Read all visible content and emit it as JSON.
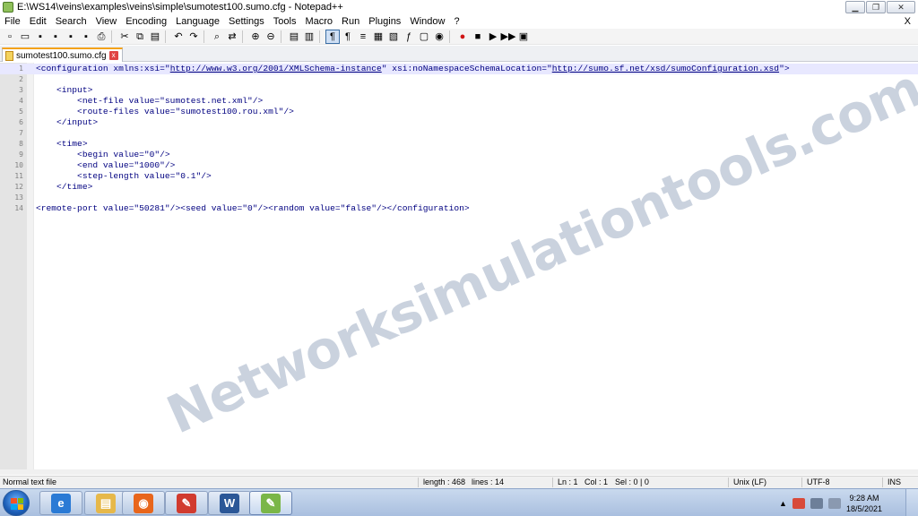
{
  "window": {
    "title": "E:\\WS14\\veins\\examples\\veins\\simple\\sumotest100.sumo.cfg - Notepad++",
    "minimize_glyph": "▁",
    "maximize_glyph": "❐",
    "close_glyph": "✕"
  },
  "menu": {
    "items": [
      "File",
      "Edit",
      "Search",
      "View",
      "Encoding",
      "Language",
      "Settings",
      "Tools",
      "Macro",
      "Run",
      "Plugins",
      "Window",
      "?"
    ],
    "doc_close": "X"
  },
  "toolbar": {
    "icons": [
      "new-file-icon",
      "open-file-icon",
      "save-icon",
      "save-all-icon",
      "close-icon",
      "close-all-icon",
      "print-icon",
      "cut-icon",
      "copy-icon",
      "paste-icon",
      "undo-icon",
      "redo-icon",
      "find-icon",
      "replace-icon",
      "zoom-in-icon",
      "zoom-out-icon",
      "sync-vertical-icon",
      "sync-horizontal-icon",
      "word-wrap-icon",
      "show-all-chars-icon",
      "indent-guide-icon",
      "user-language-icon",
      "doc-map-icon",
      "function-list-icon",
      "folder-workspace-icon",
      "monitoring-icon",
      "record-macro-icon",
      "stop-macro-icon",
      "play-macro-icon",
      "run-macro-multiple-icon",
      "save-macro-icon"
    ],
    "glyphs": [
      "▫",
      "▭",
      "▪",
      "▪",
      "▪",
      "▪",
      "⎙",
      "✂",
      "⧉",
      "▤",
      "↶",
      "↷",
      "⌕",
      "⇄",
      "⊕",
      "⊖",
      "▤",
      "▥",
      "¶",
      "¶",
      "≡",
      "▦",
      "▧",
      "ƒ",
      "▢",
      "◉",
      "●",
      "■",
      "▶",
      "▶▶",
      "▣"
    ]
  },
  "tab": {
    "label": "sumotest100.sumo.cfg",
    "close_glyph": "x"
  },
  "editor": {
    "lines": [
      {
        "n": "1",
        "text": "<configuration xmlns:xsi=\"",
        "link1": "http://www.w3.org/2001/XMLSchema-instance",
        "mid": "\" xsi:noNamespaceSchemaLocation=\"",
        "link2": "http://sumo.sf.net/xsd/sumoConfiguration.xsd",
        "end": "\">"
      },
      {
        "n": "2",
        "text": ""
      },
      {
        "n": "3",
        "text": "    <input>"
      },
      {
        "n": "4",
        "text": "        <net-file value=\"sumotest.net.xml\"/>"
      },
      {
        "n": "5",
        "text": "        <route-files value=\"sumotest100.rou.xml\"/>"
      },
      {
        "n": "6",
        "text": "    </input>"
      },
      {
        "n": "7",
        "text": ""
      },
      {
        "n": "8",
        "text": "    <time>"
      },
      {
        "n": "9",
        "text": "        <begin value=\"0\"/>"
      },
      {
        "n": "10",
        "text": "        <end value=\"1000\"/>"
      },
      {
        "n": "11",
        "text": "        <step-length value=\"0.1\"/>"
      },
      {
        "n": "12",
        "text": "    </time>"
      },
      {
        "n": "13",
        "text": ""
      },
      {
        "n": "14",
        "text": "<remote-port value=\"50281\"/><seed value=\"0\"/><random value=\"false\"/></configuration>"
      }
    ]
  },
  "watermark": "Networksimulationtools.com",
  "status": {
    "filetype": "Normal text file",
    "length": "length : 468",
    "lines": "lines : 14",
    "ln": "Ln : 1",
    "col": "Col : 1",
    "sel": "Sel : 0 | 0",
    "eol": "Unix (LF)",
    "encoding": "UTF-8",
    "mode": "INS"
  },
  "taskbar": {
    "apps": [
      {
        "name": "internet-explorer-icon",
        "glyph": "e",
        "color": "#2a7ad5"
      },
      {
        "name": "file-explorer-icon",
        "glyph": "▤",
        "color": "#e6b84a"
      },
      {
        "name": "firefox-icon",
        "glyph": "◉",
        "color": "#e8661c"
      },
      {
        "name": "drawing-app-icon",
        "glyph": "✎",
        "color": "#d13b2f"
      },
      {
        "name": "word-icon",
        "glyph": "W",
        "color": "#2b5797"
      },
      {
        "name": "notepadpp-icon",
        "glyph": "✎",
        "color": "#7ab648"
      }
    ],
    "clock_time": "9:28 AM",
    "clock_date": "18/5/2021",
    "tray_arrow": "▲"
  },
  "colors": {
    "xml_text": "#000080",
    "current_line": "#e8e8ff",
    "tab_accent": "#f3a21a"
  }
}
